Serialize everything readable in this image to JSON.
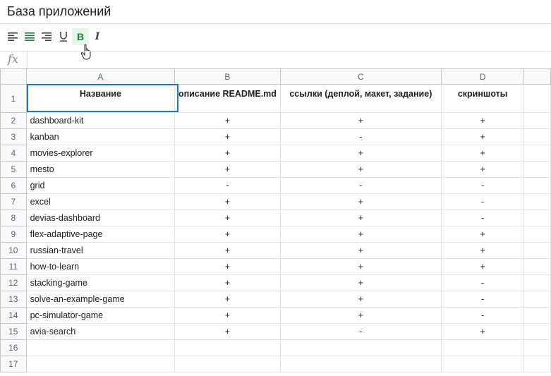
{
  "app": {
    "title": "База приложений"
  },
  "toolbar": {
    "bold_label": "B",
    "italic_label": "I"
  },
  "formula_bar": {
    "fx_label": "fx",
    "value": ""
  },
  "columns": [
    "A",
    "B",
    "C",
    "D"
  ],
  "header_row": {
    "row": "1",
    "a": "Название",
    "b": "описание README.md",
    "c": "ссылки (деплой, макет, задание)",
    "d": "скриншоты"
  },
  "rows": [
    {
      "row": "2",
      "a": "dashboard-kit",
      "b": "+",
      "c": "+",
      "d": "+"
    },
    {
      "row": "3",
      "a": "kanban",
      "b": "+",
      "c": "-",
      "d": "+"
    },
    {
      "row": "4",
      "a": "movies-explorer",
      "b": "+",
      "c": "+",
      "d": "+"
    },
    {
      "row": "5",
      "a": "mesto",
      "b": "+",
      "c": "+",
      "d": "+"
    },
    {
      "row": "6",
      "a": "grid",
      "b": "-",
      "c": "-",
      "d": "-"
    },
    {
      "row": "7",
      "a": "excel",
      "b": "+",
      "c": "+",
      "d": "-"
    },
    {
      "row": "8",
      "a": "devias-dashboard",
      "b": "+",
      "c": "+",
      "d": "-"
    },
    {
      "row": "9",
      "a": "flex-adaptive-page",
      "b": "+",
      "c": "+",
      "d": "+"
    },
    {
      "row": "10",
      "a": "russian-travel",
      "b": "+",
      "c": "+",
      "d": "+"
    },
    {
      "row": "11",
      "a": "how-to-learn",
      "b": "+",
      "c": "+",
      "d": "+"
    },
    {
      "row": "12",
      "a": "stacking-game",
      "b": "+",
      "c": "+",
      "d": "-"
    },
    {
      "row": "13",
      "a": "solve-an-example-game",
      "b": "+",
      "c": "+",
      "d": "-"
    },
    {
      "row": "14",
      "a": "pc-simulator-game",
      "b": "+",
      "c": "+",
      "d": "-"
    },
    {
      "row": "15",
      "a": "avia-search",
      "b": "+",
      "c": "-",
      "d": "+"
    },
    {
      "row": "16",
      "a": "",
      "b": "",
      "c": "",
      "d": ""
    },
    {
      "row": "17",
      "a": "",
      "b": "",
      "c": "",
      "d": ""
    }
  ]
}
